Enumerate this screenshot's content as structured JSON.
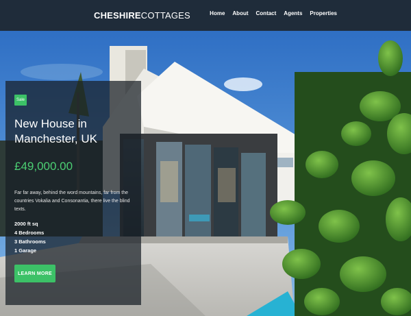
{
  "brand": {
    "part1": "CHESHIRE",
    "part2": "COTTAGES"
  },
  "nav": [
    {
      "label": "Home"
    },
    {
      "label": "About"
    },
    {
      "label": "Contact"
    },
    {
      "label": "Agents"
    },
    {
      "label": "Properties"
    }
  ],
  "listing": {
    "badge": "Sale",
    "title": "New House in Manchester, UK",
    "price": "£49,000.00",
    "description": "Far far away, behind the word mountains, far from the countries Vokalia and Consonantia, there live the blind texts.",
    "features": [
      "2000 ft sq",
      "4 Bedrooms",
      "3 Bathrooms",
      "1 Garage"
    ],
    "cta": "LEARN MORE"
  },
  "colors": {
    "nav_bg": "#1f2c3a",
    "accent_green": "#3cc167",
    "price_green": "#4ccf73"
  },
  "icons": []
}
